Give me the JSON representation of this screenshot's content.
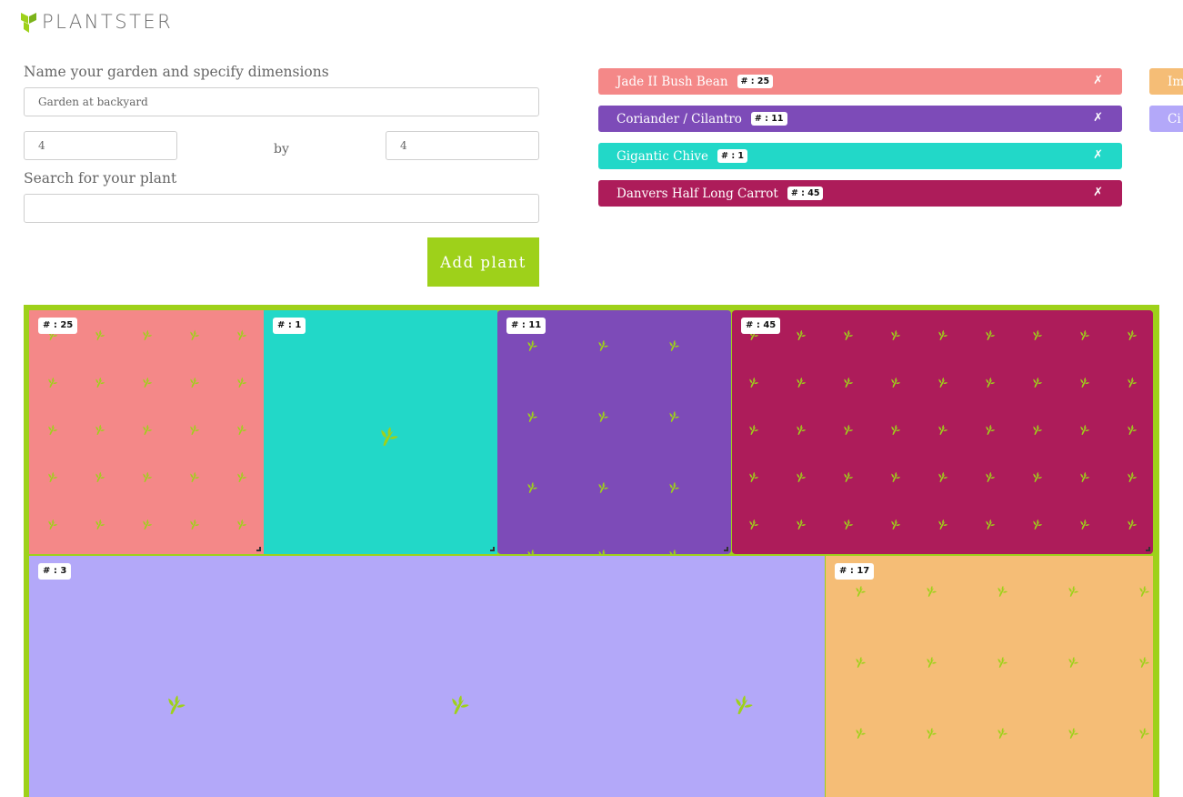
{
  "app": {
    "logo_text": "PLANTSTER",
    "accent_color": "#9ed11a"
  },
  "form": {
    "name_label": "Name your garden and specify dimensions",
    "garden_name": "Garden at backyard",
    "width_value": "4",
    "by_label": "by",
    "height_value": "4",
    "search_label": "Search for your plant",
    "search_value": "",
    "add_button": "Add plant"
  },
  "plant_tags": [
    {
      "name": "Jade II Bush Bean",
      "count": "# : 25",
      "remove": "✗",
      "color": "#f48888"
    },
    {
      "name": "Coriander / Cilantro",
      "count": "# : 11",
      "remove": "✗",
      "color": "#7d4bb8"
    },
    {
      "name": "Gigantic Chive",
      "count": "# : 1",
      "remove": "✗",
      "color": "#22d8c8"
    },
    {
      "name": "Danvers Half Long Carrot",
      "count": "# : 45",
      "remove": "✗",
      "color": "#ad1c5a"
    }
  ],
  "plant_tags_overflow": [
    {
      "name": "Im",
      "color": "#f5bd76"
    },
    {
      "name": "Ci",
      "color": "#b3a8f9"
    }
  ],
  "garden_cells": [
    {
      "badge": "# : 25",
      "color": "#f48888",
      "icon": "sprout-icon"
    },
    {
      "badge": "# : 1",
      "color": "#22d8c8",
      "icon": "sprout-icon"
    },
    {
      "badge": "# : 11",
      "color": "#7d4bb8",
      "icon": "sprout-icon"
    },
    {
      "badge": "# : 45",
      "color": "#ad1c5a",
      "icon": "sprout-icon"
    },
    {
      "badge": "# : 3",
      "color": "#b3a8f9",
      "icon": "sprout-icon"
    },
    {
      "badge": "# : 17",
      "color": "#f5bd76",
      "icon": "sprout-icon"
    }
  ]
}
